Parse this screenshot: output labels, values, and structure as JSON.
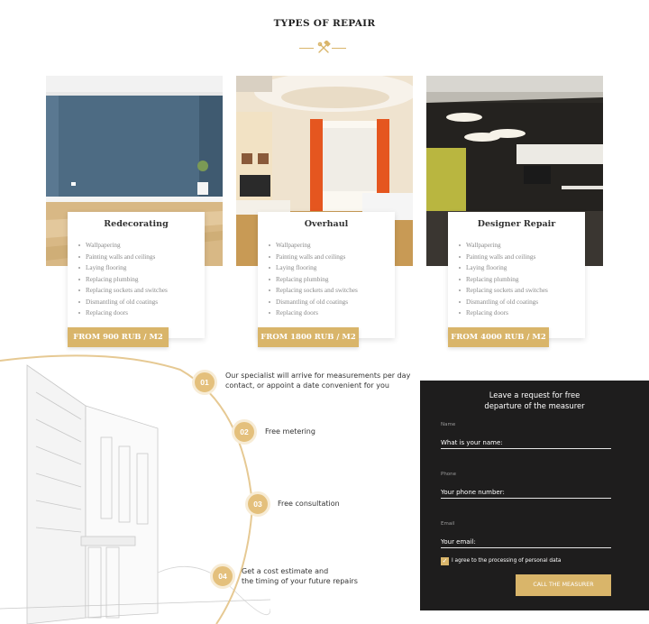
{
  "section": {
    "title": "TYPES OF REPAIR"
  },
  "cards": [
    {
      "name": "Redecorating",
      "items": [
        "Wallpapering",
        "Painting walls and ceilings",
        "Laying flooring",
        "Replacing plumbing",
        "Replacing sockets and switches",
        "Dismantling of old coatings",
        "Replacing doors"
      ],
      "price": "FROM 900 RUB / M2"
    },
    {
      "name": "Overhaul",
      "items": [
        "Wallpapering",
        "Painting walls and ceilings",
        "Laying flooring",
        "Replacing plumbing",
        "Replacing sockets and switches",
        "Dismantling of old coatings",
        "Replacing doors"
      ],
      "price": "FROM 1800 RUB / M2"
    },
    {
      "name": "Designer Repair",
      "items": [
        "Wallpapering",
        "Painting walls and ceilings",
        "Laying flooring",
        "Replacing plumbing",
        "Replacing sockets and switches",
        "Dismantling of old coatings",
        "Replacing doors"
      ],
      "price": "FROM 4000 RUB / M2"
    }
  ],
  "steps": [
    {
      "num": "01",
      "line1": "Our specialist will arrive for measurements per day",
      "line2": "contact, or appoint a date convenient for you"
    },
    {
      "num": "02",
      "line1": "Free metering",
      "line2": ""
    },
    {
      "num": "03",
      "line1": "Free consultation",
      "line2": ""
    },
    {
      "num": "04",
      "line1": "Get a cost estimate and",
      "line2": "the timing of your future repairs"
    }
  ],
  "form": {
    "heading_line1": "Leave a request for free",
    "heading_line2": "departure of the measurer",
    "name_label": "Name",
    "name_value": "What is your name:",
    "phone_label": "Phone",
    "phone_value": "Your phone number:",
    "email_label": "Email",
    "email_value": "Your email:",
    "consent": "I agree to the processing of personal data",
    "submit": "CALL THE MEASURER"
  },
  "colors": {
    "accent": "#d9b56a",
    "form_bg": "#1e1d1d"
  },
  "icons": {
    "title": "hammer-wrench-icon",
    "checkbox": "check-icon"
  }
}
